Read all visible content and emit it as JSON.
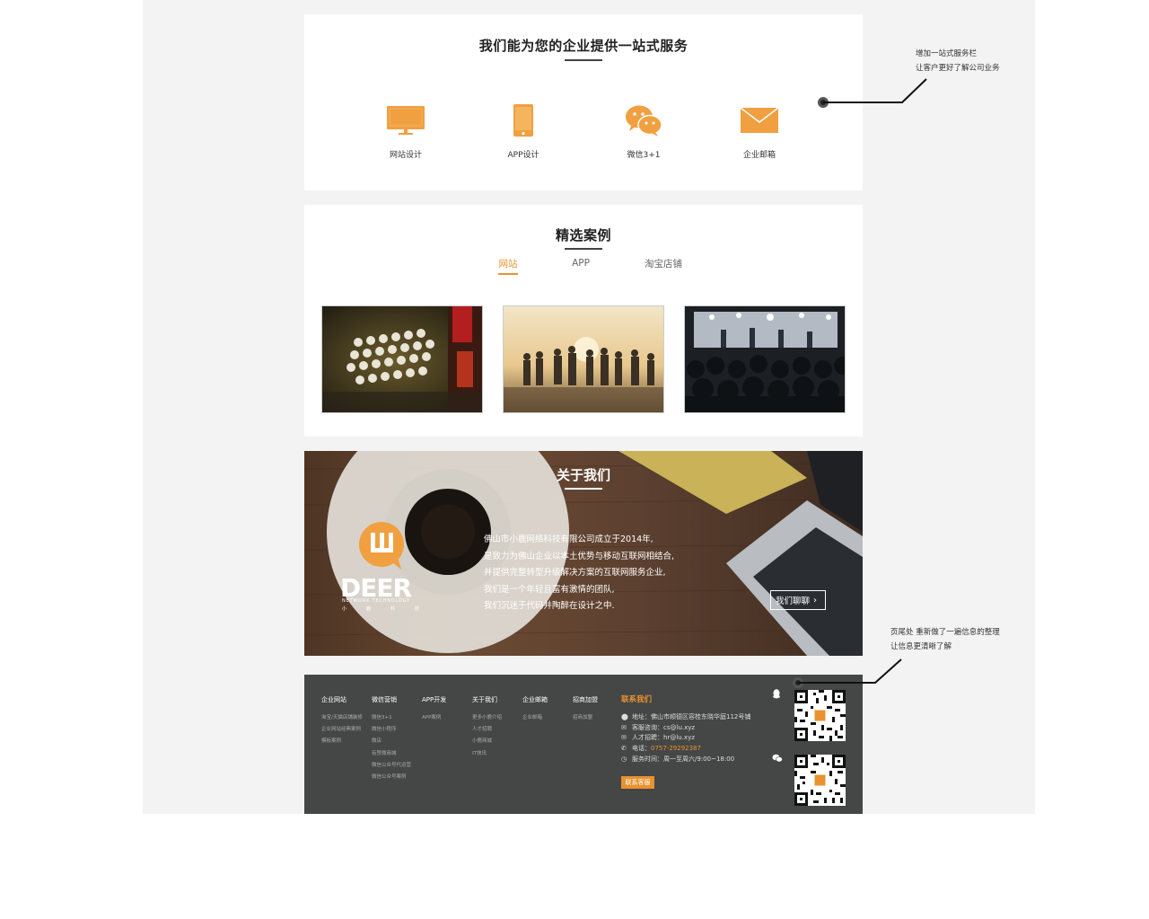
{
  "services": {
    "title": "我们能为您的企业提供一站式服务",
    "items": [
      {
        "label": "网站设计",
        "icon": "monitor-icon"
      },
      {
        "label": "APP设计",
        "icon": "phone-icon"
      },
      {
        "label": "微信3+1",
        "icon": "wechat-icon"
      },
      {
        "label": "企业邮箱",
        "icon": "mail-icon"
      }
    ]
  },
  "cases": {
    "title": "精选案例",
    "tabs": [
      {
        "label": "网站",
        "active": true
      },
      {
        "label": "APP",
        "active": false
      },
      {
        "label": "淘宝店铺",
        "active": false
      }
    ],
    "images": [
      "typewriter-photo",
      "outdoor-group-photo",
      "concert-crowd-photo"
    ]
  },
  "about": {
    "title": "关于我们",
    "lines": [
      "佛山市小鹿网络科技有限公司成立于2014年,",
      "是致力为佛山企业以本土优势与移动互联网相结合,",
      "并提供完整转型升级解决方案的互联网服务企业,",
      "我们是一个年轻且富有激情的团队,",
      "我们沉迷于代码并陶醉在设计之中."
    ],
    "chat_button": "我们聊聊",
    "logo": {
      "word": "DEER",
      "sub": "NETWORK TECHNOLOGY",
      "cn": "小鹿科技"
    }
  },
  "footer": {
    "columns": [
      {
        "heading": "企业网站",
        "items": [
          "淘宝/天猫店铺装修",
          "企业网站经典案例",
          "模板案例"
        ]
      },
      {
        "heading": "微信营销",
        "items": [
          "微信3+1",
          "微信小程序",
          "微店",
          "有赞微商城",
          "微信公众号代运营",
          "微信公众号案例"
        ]
      },
      {
        "heading": "APP开发",
        "items": [
          "APP案例"
        ]
      },
      {
        "heading": "关于我们",
        "items": [
          "更多小鹿介绍",
          "人才招聘",
          "小鹿商城",
          "IT快讯"
        ]
      },
      {
        "heading": "企业邮箱",
        "items": [
          "企业邮箱"
        ]
      },
      {
        "heading": "招商加盟",
        "items": [
          "招商加盟"
        ]
      }
    ],
    "contact": {
      "heading": "联系我们",
      "rows": [
        {
          "icon": "location-icon",
          "glyph": "⬤",
          "text": "地址：佛山市顺德区容桂东晓华庭112号铺"
        },
        {
          "icon": "mail-icon",
          "glyph": "✉",
          "text": "客服咨询：cs@lu.xyz"
        },
        {
          "icon": "mail-icon",
          "glyph": "✉",
          "text": "人才招聘：hr@lu.xyz"
        },
        {
          "icon": "phone-icon",
          "glyph": "✆",
          "label": "电话：",
          "text": "0757-29292387",
          "accent": true
        },
        {
          "icon": "clock-icon",
          "glyph": "◷",
          "text": "服务时间：周一至周六/9:00~18:00"
        }
      ],
      "button": "联系客服"
    }
  },
  "annotations": {
    "top": [
      "增加一站式服务栏",
      "让客户更好了解公司业务"
    ],
    "bottom": [
      "页尾处 重新做了一遍信息的整理",
      "让信息更清晰了解"
    ]
  },
  "colors": {
    "accent": "#e89230",
    "footer_bg": "#454646",
    "canvas": "#f3f3f3"
  }
}
